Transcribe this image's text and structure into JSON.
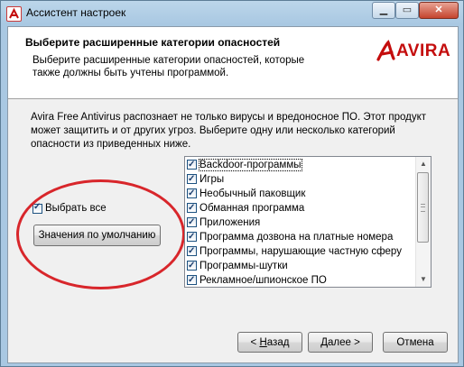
{
  "window": {
    "title": "Ассистент настроек",
    "app_icon": "avira-icon",
    "controls": [
      "minimize-icon",
      "maximize-icon",
      "close-icon"
    ]
  },
  "header": {
    "title": "Выберите расширенные категории опасностей",
    "description": "Выберите расширенные категории опасностей, которые также должны быть учтены программой.",
    "logo_text": "AVIRA"
  },
  "intro_text": "Avira Free Antivirus распознает не только вирусы и вредоносное ПО. Этот продукт может защитить и от других угроз. Выберите одну или несколько категорий опасности из приведенных ниже.",
  "select_all": {
    "label": "Выбрать все",
    "checked": true
  },
  "defaults_button": {
    "label": "Значения по умолчанию"
  },
  "categories": [
    {
      "label": "Backdoor-программы",
      "checked": true
    },
    {
      "label": "Игры",
      "checked": true
    },
    {
      "label": "Необычный паковщик",
      "checked": true
    },
    {
      "label": "Обманная программа",
      "checked": true
    },
    {
      "label": "Приложения",
      "checked": true
    },
    {
      "label": "Программа дозвона на платные номера",
      "checked": true
    },
    {
      "label": "Программы, нарушающие частную сферу",
      "checked": true
    },
    {
      "label": "Программы-шутки",
      "checked": true
    },
    {
      "label": "Рекламное/шпионское ПО",
      "checked": true
    }
  ],
  "footer": {
    "back_prefix": "< ",
    "back_key": "Н",
    "back_rest": "азад",
    "next_key": "Д",
    "next_rest": "алее >",
    "cancel_label": "Отмена"
  },
  "colors": {
    "annotation_ellipse": "#d8262b",
    "brand_red": "#c40d0d"
  }
}
